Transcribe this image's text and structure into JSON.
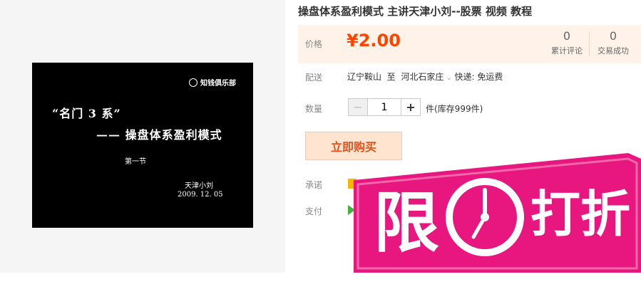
{
  "thumbnail": {
    "logo_text": "知钱俱乐部",
    "series_text": "“名门 3 系”",
    "title_text": "—— 操盘体系盈利模式",
    "section_text": "第一节",
    "author_text": "天津小刘",
    "date_text": "2009. 12. 05"
  },
  "product": {
    "title": "操盘体系盈利模式 主讲天津小刘--股票 视频 教程"
  },
  "price": {
    "label": "价格",
    "value": "¥2.00",
    "reviews_count": "0",
    "reviews_label": "累计评论",
    "deals_count": "0",
    "deals_label": "交易成功"
  },
  "shipping": {
    "label": "配送",
    "from": "辽宁鞍山",
    "to_word": "至",
    "destination": "河北石家庄",
    "method": "快递: 免运费"
  },
  "quantity": {
    "label": "数量",
    "value": "1",
    "stock": "件(库存999件)"
  },
  "buy_button": "立即购买",
  "promise": {
    "label": "承诺"
  },
  "payment": {
    "label": "支付"
  },
  "banner": {
    "text_xian": "限",
    "text_daze": "打折",
    "color": "#e8177f"
  },
  "colors": {
    "price": "#ff4400",
    "accent": "#e5511d",
    "price_bg": "#fff2e8"
  }
}
